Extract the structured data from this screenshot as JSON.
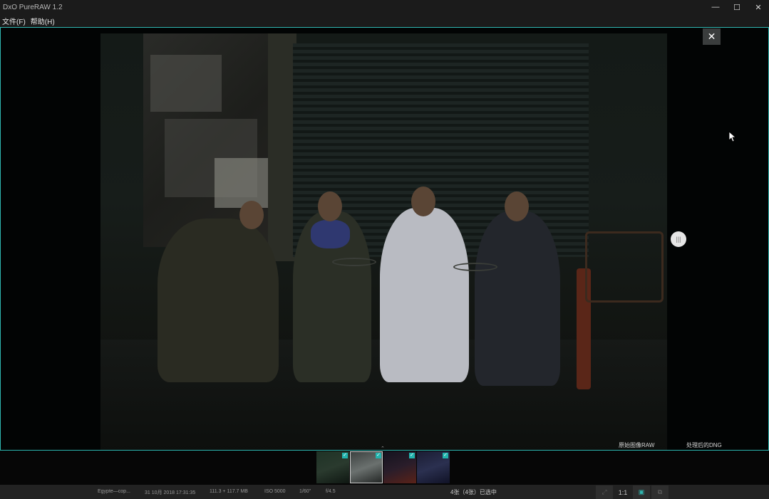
{
  "window": {
    "title": "DxO PureRAW 1.2",
    "controls": {
      "minimize": "—",
      "maximize": "☐",
      "close": "✕"
    }
  },
  "menu": {
    "items": [
      {
        "label": "文件(F)"
      },
      {
        "label": "帮助(H)"
      }
    ]
  },
  "viewer": {
    "close_glyph": "✕",
    "handle_glyph": "|||",
    "label_left": "原始图像RAW",
    "label_right": "处理后的DNG",
    "chevron": "⌃",
    "icons": [
      "close-icon",
      "split-handle-icon",
      "cursor-icon",
      "chevron-up-icon"
    ]
  },
  "filmstrip": {
    "thumbnails": [
      {
        "name": "thumbnail-1",
        "checked": true,
        "colors": [
          "#1f3326",
          "#2a3a2e",
          "#0f1712"
        ]
      },
      {
        "name": "thumbnail-2",
        "checked": true,
        "selected": true,
        "colors": [
          "#3a3f3e",
          "#6b716f",
          "#202322"
        ]
      },
      {
        "name": "thumbnail-3",
        "checked": true,
        "colors": [
          "#14131f",
          "#2a1d2a",
          "#5a2218"
        ]
      },
      {
        "name": "thumbnail-4",
        "checked": true,
        "colors": [
          "#1b1d33",
          "#2b3050",
          "#101226"
        ]
      }
    ],
    "check_glyph": "✓"
  },
  "status": {
    "filename": "Egypte—cop...",
    "datetime": "31 10月 2018 17:31:35",
    "filesize": "111.3 + 117.7 MB",
    "iso": "ISO 5000",
    "shutter": "1/60\"",
    "aperture": "f/4.5",
    "selection": "4张（4张）已选中",
    "tools": {
      "zoom_fit": "⤢",
      "zoom_1to1": "1:1",
      "single_view": "▣",
      "compare_view": "⧉"
    }
  },
  "colors": {
    "accent": "#2fb7b1",
    "titlebar": "#1b1b1b",
    "statusbar": "#222222"
  }
}
